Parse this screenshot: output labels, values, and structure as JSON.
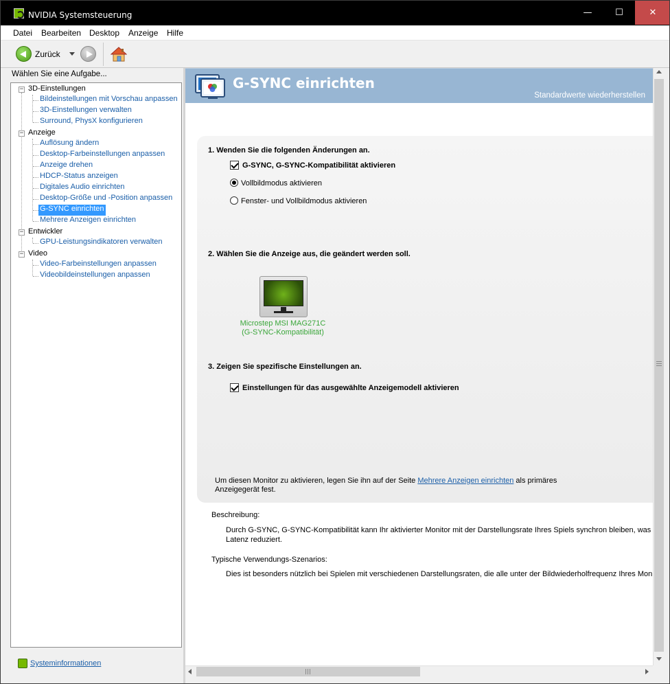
{
  "window": {
    "title": "NVIDIA Systemsteuerung",
    "caption_buttons": {
      "minimize": "—",
      "maximize": "☐",
      "close": "✕"
    },
    "close_color": "#c44a4a"
  },
  "menu": [
    "Datei",
    "Bearbeiten",
    "Desktop",
    "Anzeige",
    "Hilfe"
  ],
  "toolbar": {
    "back_label": "Zurück",
    "icons": [
      "back-arrow-icon",
      "dropdown-icon",
      "forward-arrow-icon",
      "home-icon"
    ]
  },
  "sidebar": {
    "task_label": "Wählen Sie eine Aufgabe...",
    "categories": [
      {
        "label": "3D-Einstellungen",
        "items": [
          "Bildeinstellungen mit Vorschau anpassen",
          "3D-Einstellungen verwalten",
          "Surround, PhysX konfigurieren"
        ]
      },
      {
        "label": "Anzeige",
        "items": [
          "Auflösung ändern",
          "Desktop-Farbeinstellungen anpassen",
          "Anzeige drehen",
          "HDCP-Status anzeigen",
          "Digitales Audio einrichten",
          "Desktop-Größe und -Position anpassen",
          "G-SYNC einrichten",
          "Mehrere Anzeigen einrichten"
        ]
      },
      {
        "label": "Entwickler",
        "items": [
          "GPU-Leistungsindikatoren verwalten"
        ]
      },
      {
        "label": "Video",
        "items": [
          "Video-Farbeinstellungen anpassen",
          "Videobildeinstellungen anpassen"
        ]
      }
    ],
    "selected_item": "G-SYNC einrichten",
    "expander_symbol": "−",
    "system_info_link": "Systeminformationen"
  },
  "content": {
    "title": "G-SYNC einrichten",
    "restore_link": "Standardwerte wiederherstellen",
    "header_color": "#98b6d3",
    "section1": {
      "title": "1. Wenden Sie die folgenden Änderungen an.",
      "checkbox_label": "G-SYNC, G-SYNC-Kompatibilität aktivieren",
      "checkbox_checked": true,
      "radio1_label": "Vollbildmodus aktivieren",
      "radio1_selected": true,
      "radio2_label": "Fenster- und Vollbildmodus aktivieren",
      "radio2_selected": false
    },
    "section2": {
      "title": "2. Wählen Sie die Anzeige aus, die geändert werden soll.",
      "monitor_name_line1": "Microstep MSI MAG271C",
      "monitor_name_line2": "(G-SYNC-Kompatibilität)",
      "monitor_label_color": "#3aa63a"
    },
    "section3": {
      "title": "3. Zeigen Sie spezifische Einstellungen an.",
      "checkbox_label": "Einstellungen für das ausgewählte Anzeigemodell aktivieren",
      "checkbox_checked": true
    },
    "hint": {
      "before": "Um diesen Monitor zu aktivieren, legen Sie ihn auf der Seite ",
      "link": "Mehrere Anzeigen einrichten",
      "after": " als primäres",
      "line2": "Anzeigegerät fest."
    },
    "description_label": "Beschreibung:",
    "description_line1": "Durch G-SYNC, G-SYNC-Kompatibilität kann Ihr aktivierter Monitor mit der Darstellungsrate Ihres Spiels synchron bleiben, was die G",
    "description_line2": "Latenz reduziert.",
    "usage_label": "Typische Verwendungs-Szenarios:",
    "usage_text": "Dies ist besonders nützlich bei Spielen mit verschiedenen Darstellungsraten, die alle unter der Bildwiederholfrequenz Ihres Monitor"
  }
}
